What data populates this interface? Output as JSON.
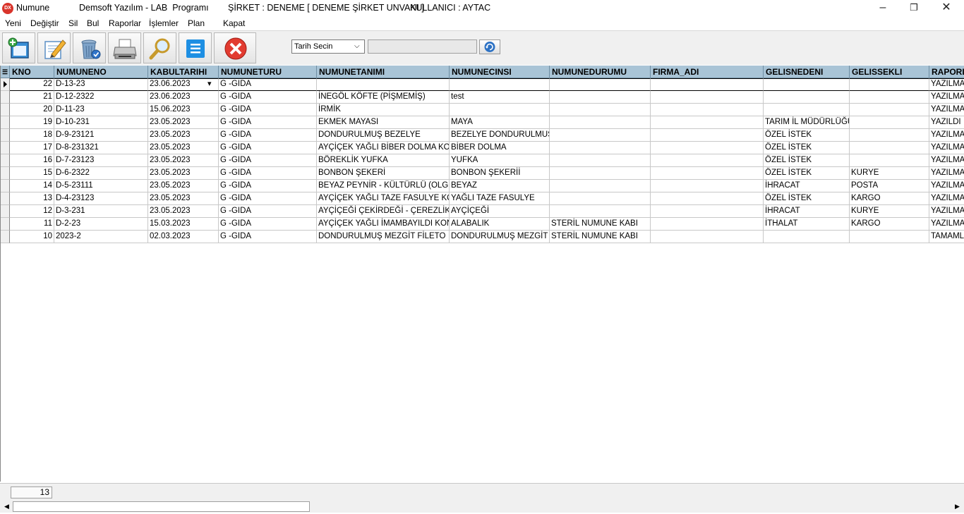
{
  "titlebar": {
    "icon": "DX",
    "app": "Numune",
    "vendor": "Demsoft Yazılım - LAB  Programı",
    "company": "ŞİRKET : DENEME [ DENEME ŞİRKET UNVANI ]",
    "user": "KULLANICI : AYTAC",
    "minimize": "–",
    "maximize": "❐",
    "close": "✕"
  },
  "menu": [
    "Yeni",
    "Değiştir",
    "Sil",
    "Bul",
    "Raporlar",
    "İşlemler",
    "Plan",
    "Kapat"
  ],
  "toolbar": {
    "buttons": [
      "new-icon",
      "edit-icon",
      "delete-icon",
      "print-icon",
      "search-icon",
      "list-icon",
      "close-icon"
    ],
    "date_select": "Tarih Secin",
    "date_value": ""
  },
  "grid": {
    "columns": [
      "KNO",
      "NUMUNENO",
      "KABULTARIHI",
      "NUMUNETURU",
      "NUMUNETANIMI",
      "NUMUNECINSI",
      "NUMUNEDURUMU",
      "FIRMA_ADI",
      "GELISNEDENI",
      "GELISSEKLI",
      "RAPORI"
    ],
    "rows": [
      [
        "22",
        "D-13-23",
        "23.06.2023",
        "G -GIDA",
        "",
        "",
        "",
        "",
        "",
        "",
        "YAZILMA"
      ],
      [
        "21",
        "D-12-2322",
        "23.06.2023",
        "G -GIDA",
        "İNEGÖL KÖFTE (PİŞMEMİŞ)",
        "test",
        "",
        "",
        "",
        "",
        "YAZILMA"
      ],
      [
        "20",
        "D-11-23",
        "15.06.2023",
        "G -GIDA",
        "İRMİK",
        "",
        "",
        "",
        "",
        "",
        "YAZILMA"
      ],
      [
        "19",
        "D-10-231",
        "23.05.2023",
        "G -GIDA",
        "EKMEK MAYASI",
        "MAYA",
        "",
        "",
        "TARIM İL MÜDÜRLÜĞÜ",
        "",
        "YAZILDI"
      ],
      [
        "18",
        "D-9-23121",
        "23.05.2023",
        "G -GIDA",
        "DONDURULMUŞ BEZELYE",
        "BEZELYE DONDURULMUŞ",
        "",
        "",
        "ÖZEL İSTEK",
        "",
        "YAZILMA"
      ],
      [
        "17",
        "D-8-231321",
        "23.05.2023",
        "G -GIDA",
        "AYÇİÇEK YAĞLI BİBER DOLMA KONSERVE",
        "BİBER DOLMA",
        "",
        "",
        "ÖZEL İSTEK",
        "",
        "YAZILMA"
      ],
      [
        "16",
        "D-7-23123",
        "23.05.2023",
        "G -GIDA",
        "BÖREKLİK YUFKA",
        "YUFKA",
        "",
        "",
        "ÖZEL İSTEK",
        "",
        "YAZILMA"
      ],
      [
        "15",
        "D-6-2322",
        "23.05.2023",
        "G -GIDA",
        "BONBON ŞEKERİ",
        "BONBON ŞEKERİİ",
        "",
        "",
        "ÖZEL İSTEK",
        "KURYE",
        "YAZILMA"
      ],
      [
        "14",
        "D-5-23111",
        "23.05.2023",
        "G -GIDA",
        "BEYAZ PEYNİR - KÜLTÜRLÜ (OLGUNLAŞTIRILMIŞ)",
        "BEYAZ",
        "",
        "",
        "İHRACAT",
        "POSTA",
        "YAZILMA"
      ],
      [
        "13",
        "D-4-23123",
        "23.05.2023",
        "G -GIDA",
        "AYÇİÇEK YAĞLI TAZE FASULYE KONSERVE",
        "YAĞLI TAZE FASULYE",
        "",
        "",
        "ÖZEL İSTEK",
        "KARGO",
        "YAZILMA"
      ],
      [
        "12",
        "D-3-231",
        "23.05.2023",
        "G -GIDA",
        "AYÇİÇEĞİ ÇEKİRDEĞİ - ÇEREZLİK",
        "AYÇİÇEĞİ",
        "",
        "",
        "İHRACAT",
        "KURYE",
        "YAZILMA"
      ],
      [
        "11",
        "D-2-23",
        "15.03.2023",
        "G -GIDA",
        "AYÇİÇEK YAĞLI İMAMBAYILDI KONSERVE",
        "ALABALIK",
        "STERİL NUMUNE KABI",
        "",
        "İTHALAT",
        "KARGO",
        "YAZILMA"
      ],
      [
        "10",
        "2023-2",
        "02.03.2023",
        "G -GIDA",
        "DONDURULMUŞ MEZGİT FİLETO",
        "DONDURULMUŞ MEZGİT FİLETO",
        "STERİL NUMUNE KABI",
        "",
        "",
        "",
        "TAMAML"
      ]
    ]
  },
  "status": {
    "record_count": "13"
  }
}
